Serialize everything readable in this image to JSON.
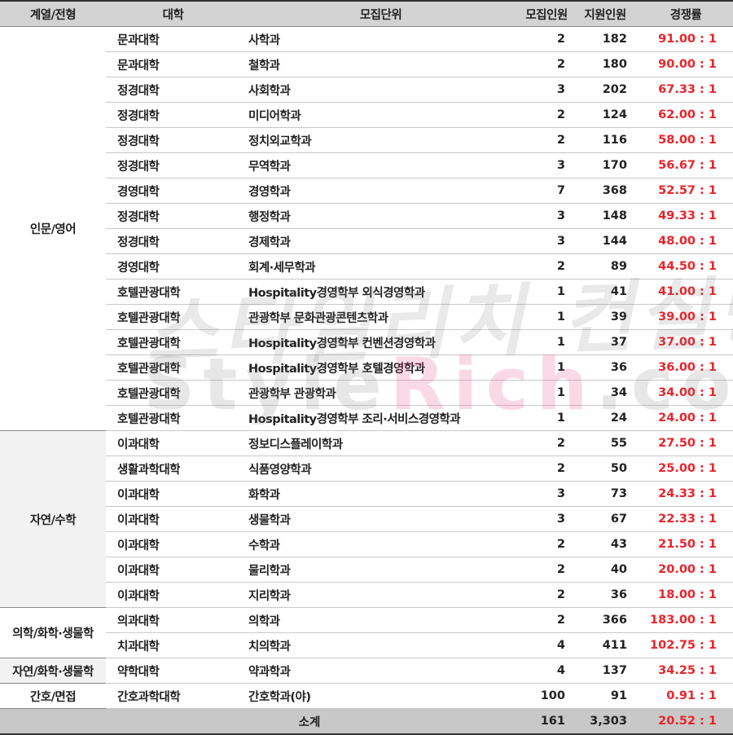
{
  "headers": {
    "group": "계열/전형",
    "college": "대학",
    "unit": "모집단위",
    "quota": "모집인원",
    "applicants": "지원인원",
    "ratio": "경쟁률"
  },
  "groups": {
    "humanities": "인문/영어",
    "natural_math": "자연/수학",
    "medical": "의학/화학·생물학",
    "pharmacy": "자연/화학·생물학",
    "nursing": "간호/면접"
  },
  "rows": [
    {
      "college": "문과대학",
      "unit": "사학과",
      "quota": "2",
      "applicants": "182",
      "ratio": "91.00 : 1"
    },
    {
      "college": "문과대학",
      "unit": "철학과",
      "quota": "2",
      "applicants": "180",
      "ratio": "90.00 : 1"
    },
    {
      "college": "정경대학",
      "unit": "사회학과",
      "quota": "3",
      "applicants": "202",
      "ratio": "67.33 : 1"
    },
    {
      "college": "정경대학",
      "unit": "미디어학과",
      "quota": "2",
      "applicants": "124",
      "ratio": "62.00 : 1"
    },
    {
      "college": "정경대학",
      "unit": "정치외교학과",
      "quota": "2",
      "applicants": "116",
      "ratio": "58.00 : 1"
    },
    {
      "college": "정경대학",
      "unit": "무역학과",
      "quota": "3",
      "applicants": "170",
      "ratio": "56.67 : 1"
    },
    {
      "college": "경영대학",
      "unit": "경영학과",
      "quota": "7",
      "applicants": "368",
      "ratio": "52.57 : 1"
    },
    {
      "college": "정경대학",
      "unit": "행정학과",
      "quota": "3",
      "applicants": "148",
      "ratio": "49.33 : 1"
    },
    {
      "college": "정경대학",
      "unit": "경제학과",
      "quota": "3",
      "applicants": "144",
      "ratio": "48.00 : 1"
    },
    {
      "college": "경영대학",
      "unit": "회계·세무학과",
      "quota": "2",
      "applicants": "89",
      "ratio": "44.50 : 1"
    },
    {
      "college": "호텔관광대학",
      "unit": "Hospitality경영학부 외식경영학과",
      "quota": "1",
      "applicants": "41",
      "ratio": "41.00 : 1"
    },
    {
      "college": "호텔관광대학",
      "unit": "관광학부 문화관광콘텐츠학과",
      "quota": "1",
      "applicants": "39",
      "ratio": "39.00 : 1"
    },
    {
      "college": "호텔관광대학",
      "unit": "Hospitality경영학부 컨벤션경영학과",
      "quota": "1",
      "applicants": "37",
      "ratio": "37.00 : 1"
    },
    {
      "college": "호텔관광대학",
      "unit": "Hospitality경영학부 호텔경영학과",
      "quota": "1",
      "applicants": "36",
      "ratio": "36.00 : 1"
    },
    {
      "college": "호텔관광대학",
      "unit": "관광학부 관광학과",
      "quota": "1",
      "applicants": "34",
      "ratio": "34.00 : 1"
    },
    {
      "college": "호텔관광대학",
      "unit": "Hospitality경영학부 조리·서비스경영학과",
      "quota": "1",
      "applicants": "24",
      "ratio": "24.00 : 1"
    },
    {
      "college": "이과대학",
      "unit": "정보디스플레이학과",
      "quota": "2",
      "applicants": "55",
      "ratio": "27.50 : 1"
    },
    {
      "college": "생활과학대학",
      "unit": "식품영양학과",
      "quota": "2",
      "applicants": "50",
      "ratio": "25.00 : 1"
    },
    {
      "college": "이과대학",
      "unit": "화학과",
      "quota": "3",
      "applicants": "73",
      "ratio": "24.33 : 1"
    },
    {
      "college": "이과대학",
      "unit": "생물학과",
      "quota": "3",
      "applicants": "67",
      "ratio": "22.33 : 1"
    },
    {
      "college": "이과대학",
      "unit": "수학과",
      "quota": "2",
      "applicants": "43",
      "ratio": "21.50 : 1"
    },
    {
      "college": "이과대학",
      "unit": "물리학과",
      "quota": "2",
      "applicants": "40",
      "ratio": "20.00 : 1"
    },
    {
      "college": "이과대학",
      "unit": "지리학과",
      "quota": "2",
      "applicants": "36",
      "ratio": "18.00 : 1"
    },
    {
      "college": "의과대학",
      "unit": "의학과",
      "quota": "2",
      "applicants": "366",
      "ratio": "183.00 : 1"
    },
    {
      "college": "치과대학",
      "unit": "치의학과",
      "quota": "4",
      "applicants": "411",
      "ratio": "102.75 : 1"
    },
    {
      "college": "약학대학",
      "unit": "약과학과",
      "quota": "4",
      "applicants": "137",
      "ratio": "34.25 : 1"
    },
    {
      "college": "간호과학대학",
      "unit": "간호학과(야)",
      "quota": "100",
      "applicants": "91",
      "ratio": "0.91 : 1"
    }
  ],
  "total": {
    "label": "소계",
    "quota": "161",
    "applicants": "3,303",
    "ratio": "20.52 : 1"
  },
  "watermark": {
    "line1": "스타일리치 컨설팅",
    "line2_a": "Style",
    "line2_b": "Rich",
    "line2_c": ".co.kr"
  },
  "colors": {
    "ratio": "#e8242a",
    "header_bg": "#d3d3d3",
    "total_bg": "#c8c8c8"
  }
}
